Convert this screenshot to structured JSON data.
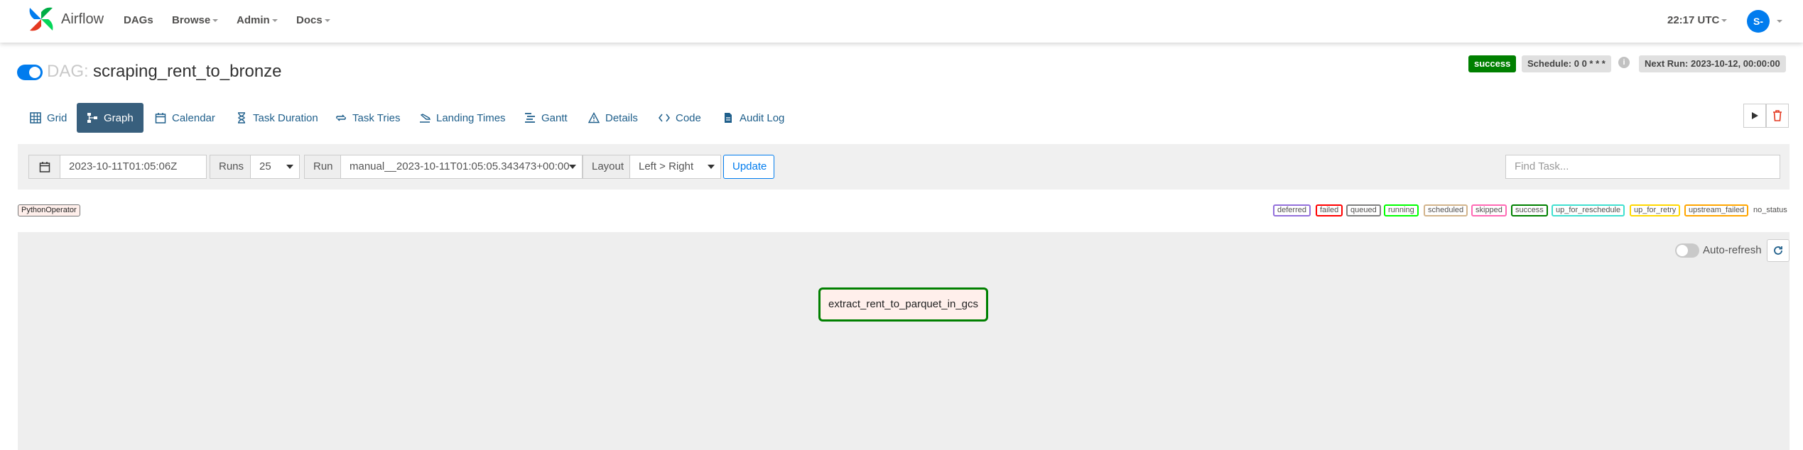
{
  "navbar": {
    "brand": "Airflow",
    "items": [
      {
        "label": "DAGs"
      },
      {
        "label": "Browse"
      },
      {
        "label": "Admin"
      },
      {
        "label": "Docs"
      }
    ],
    "time": "22:17 UTC",
    "user_initials": "S-"
  },
  "dag": {
    "prefix": "DAG:",
    "name": "scraping_rent_to_bronze",
    "paused": false,
    "status_badge": "success",
    "schedule": "Schedule: 0 0 * * *",
    "next_run": "Next Run: 2023-10-12, 00:00:00"
  },
  "tabs": [
    {
      "label": "Grid",
      "icon": "grid-icon"
    },
    {
      "label": "Graph",
      "icon": "graph-icon",
      "active": true
    },
    {
      "label": "Calendar",
      "icon": "calendar-icon"
    },
    {
      "label": "Task Duration",
      "icon": "hourglass-icon"
    },
    {
      "label": "Task Tries",
      "icon": "retry-icon"
    },
    {
      "label": "Landing Times",
      "icon": "landing-icon"
    },
    {
      "label": "Gantt",
      "icon": "gantt-icon"
    },
    {
      "label": "Details",
      "icon": "warning-triangle-icon"
    },
    {
      "label": "Code",
      "icon": "code-icon"
    },
    {
      "label": "Audit Log",
      "icon": "file-icon"
    }
  ],
  "filters": {
    "date_value": "2023-10-11T01:05:06Z",
    "runs_label": "Runs",
    "runs_value": "25",
    "run_label": "Run",
    "run_value": "manual__2023-10-11T01:05:05.343473+00:00",
    "layout_label": "Layout",
    "layout_value": "Left > Right",
    "update_label": "Update",
    "find_placeholder": "Find Task..."
  },
  "operator_badge": "PythonOperator",
  "legend": [
    {
      "label": "deferred",
      "color": "#9370db"
    },
    {
      "label": "failed",
      "color": "#ff0000"
    },
    {
      "label": "queued",
      "color": "#808080"
    },
    {
      "label": "running",
      "color": "#00ff00"
    },
    {
      "label": "scheduled",
      "color": "#d2b48c"
    },
    {
      "label": "skipped",
      "color": "#ff69b4"
    },
    {
      "label": "success",
      "color": "#008000"
    },
    {
      "label": "up_for_reschedule",
      "color": "#40e0d0"
    },
    {
      "label": "up_for_retry",
      "color": "#ffd700"
    },
    {
      "label": "upstream_failed",
      "color": "#ffa500"
    }
  ],
  "legend_no_status": "no_status",
  "graph": {
    "auto_refresh_label": "Auto-refresh",
    "auto_refresh_on": false,
    "task": {
      "label": "extract_rent_to_parquet_in_gcs",
      "status": "success"
    }
  },
  "colors": {
    "accent": "#017cee",
    "active_tab": "#385f7d",
    "success": "#008000"
  }
}
